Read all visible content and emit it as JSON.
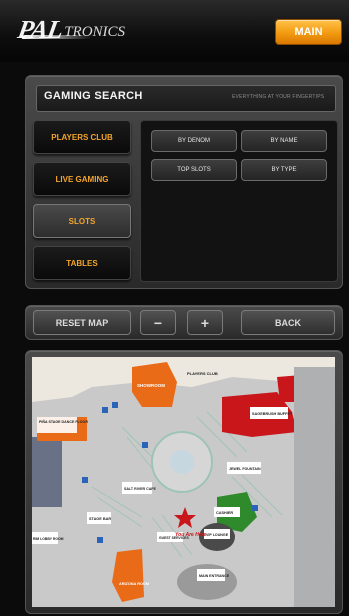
{
  "header": {
    "logo_main": "PAL",
    "logo_sub": "TRONICS",
    "main_button": "MAIN"
  },
  "search": {
    "title": "GAMING SEARCH",
    "tagline": "EVERYTHING AT YOUR FINGERTIPS",
    "categories": [
      {
        "label": "PLAYERS CLUB"
      },
      {
        "label": "LIVE GAMING"
      },
      {
        "label": "SLOTS"
      },
      {
        "label": "TABLES"
      }
    ],
    "active_category": "SLOTS",
    "options": [
      {
        "label": "BY DENOM"
      },
      {
        "label": "BY NAME"
      },
      {
        "label": "TOP SLOTS"
      },
      {
        "label": "BY TYPE"
      }
    ]
  },
  "map_controls": {
    "reset": "RESET MAP",
    "zoom_out": "−",
    "zoom_in": "+",
    "back": "BACK"
  },
  "map": {
    "labels": {
      "showroom": "SHOWROOM",
      "players_club": "PLAYERS CLUB",
      "pina_stage": "PIÑA STAGE DANCE FLOOR",
      "sagebrush_buffet": "SAGEBRUSH BUFFET",
      "jewel_fountain": "JEWEL FOUNTAIN",
      "cashier": "CASHIER",
      "salt_river_cafe": "SALT RIVER CAFE",
      "stage_bar": "STAGE BAR",
      "you_are_here": "You Are Here",
      "guest_services": "GUEST SERVICES",
      "vip_lounge": "VIP LOUNGE",
      "main_entrance": "MAIN ENTRANCE",
      "arizona_room": "ARIZONA ROOM",
      "rim_lobby": "RIM LOBBY ROOM"
    },
    "colors": {
      "showroom": "#e96b17",
      "buffet": "#c8161a",
      "cashier": "#2f8a2c",
      "stage": "#e96b17",
      "marker": "#c8161a"
    }
  }
}
